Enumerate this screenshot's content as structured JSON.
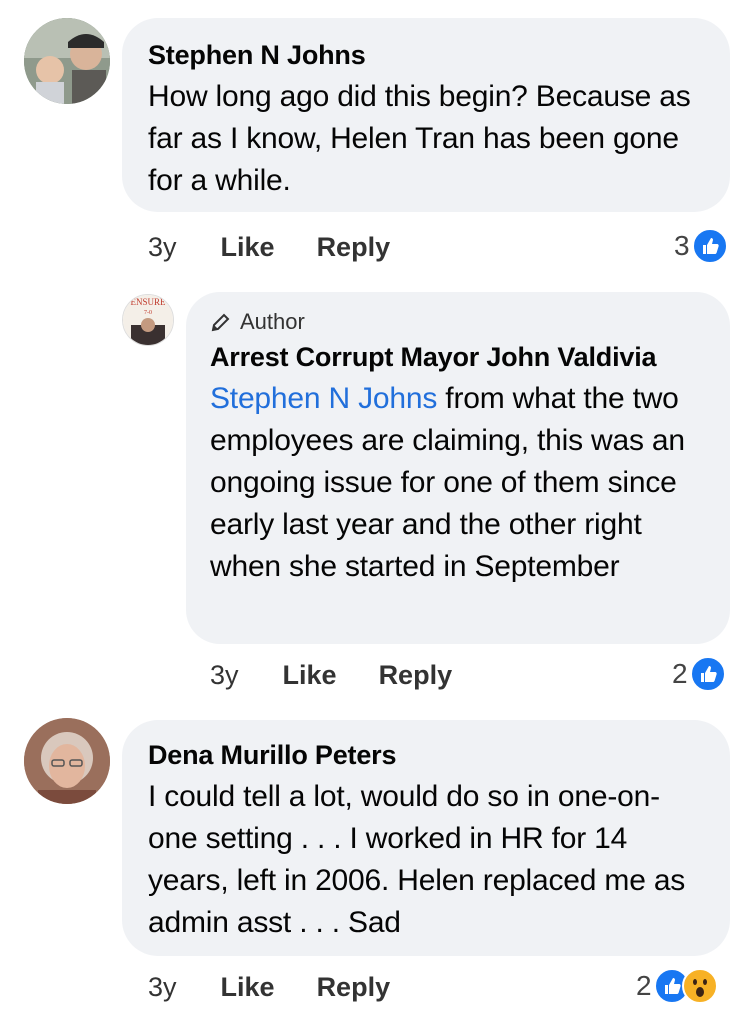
{
  "comments": [
    {
      "author": "Stephen N Johns",
      "text": "How long ago did this begin? Because as far as I know, Helen Tran has been gone for a while.",
      "time": "3y",
      "like_label": "Like",
      "reply_label": "Reply",
      "reaction_count": "3",
      "reactions": [
        "like-icon"
      ]
    },
    {
      "badge": "Author",
      "author": "Arrest Corrupt Mayor John Valdivia",
      "mention": "Stephen N Johns",
      "text": " from what the two employees are claiming, this was an ongoing issue for one of them since early last year and the other right when she started in September",
      "time": "3y",
      "like_label": "Like",
      "reply_label": "Reply",
      "reaction_count": "2",
      "reactions": [
        "like-icon"
      ],
      "avatar_text": "ENSURE 7-0"
    },
    {
      "author": "Dena Murillo Peters",
      "text": "I could tell a lot, would do so in one-on-one setting . . . I worked in HR for 14 years, left in 2006. Helen replaced me as admin asst . . . Sad",
      "time": "3y",
      "like_label": "Like",
      "reply_label": "Reply",
      "reaction_count": "2",
      "reactions": [
        "like-icon",
        "wow-icon"
      ]
    }
  ],
  "colors": {
    "bubble": "#f0f2f5",
    "mention": "#216fdb",
    "like": "#1877f2",
    "wow": "#f7b125"
  }
}
